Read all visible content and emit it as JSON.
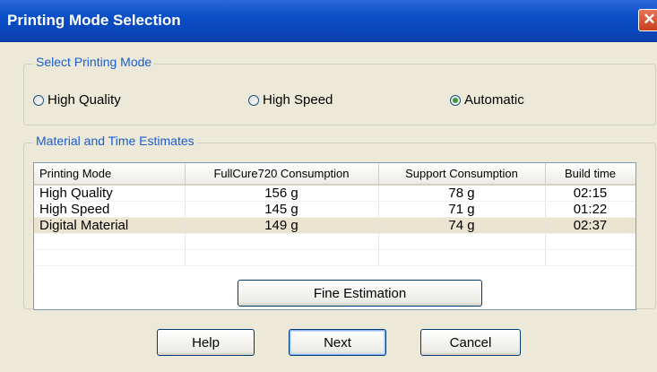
{
  "window": {
    "title": "Printing Mode Selection"
  },
  "mode_group": {
    "legend": "Select Printing Mode",
    "options": [
      {
        "label": "High Quality",
        "selected": false
      },
      {
        "label": "High Speed",
        "selected": false
      },
      {
        "label": "Automatic",
        "selected": true
      }
    ]
  },
  "estimates_group": {
    "legend": "Material and Time Estimates",
    "columns": [
      "Printing Mode",
      "FullCure720 Consumption",
      "Support Consumption",
      "Build time"
    ],
    "rows": [
      {
        "mode": "High Quality",
        "fullcure": "156 g",
        "support": "78 g",
        "time": "02:15"
      },
      {
        "mode": "High Speed",
        "fullcure": "145 g",
        "support": "71 g",
        "time": "01:22"
      },
      {
        "mode": "Digital Material",
        "fullcure": "149 g",
        "support": "74 g",
        "time": "02:37"
      }
    ],
    "fine_estimation_label": "Fine Estimation"
  },
  "buttons": {
    "help": "Help",
    "next": "Next",
    "cancel": "Cancel"
  },
  "colors": {
    "titlebar": "#0a4fc8",
    "legend_text": "#1a5cd4",
    "selected_row": "#ebe4d1"
  }
}
